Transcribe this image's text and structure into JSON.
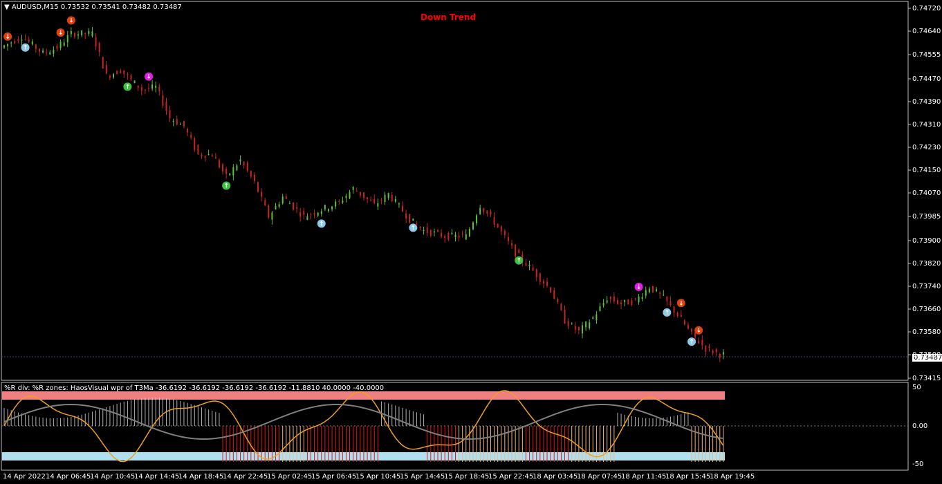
{
  "symbol": {
    "triangle_icon": "down-triangle-icon",
    "text": "AUDUSD,M15  0.73532 0.73541 0.73482 0.73487"
  },
  "trend_label": "Down Trend",
  "indicator_text": "%R div: %R zones: HaosVisual wpr of T3Ma -36.6192 -36.6192 -36.6192 -36.6192 -11.8810 40.0000 -40.0000",
  "current_price": "0.73487",
  "price_axis": [
    "0.74720",
    "0.74640",
    "0.74555",
    "0.74470",
    "0.74390",
    "0.74310",
    "0.74230",
    "0.74150",
    "0.74070",
    "0.73985",
    "0.73900",
    "0.73820",
    "0.73740",
    "0.73660",
    "0.73580",
    "0.73500",
    "0.73415"
  ],
  "indicator_axis": [
    "50",
    "0.00",
    "-50"
  ],
  "time_axis": [
    "14 Apr 2022",
    "14 Apr 06:45",
    "14 Apr 10:45",
    "14 Apr 14:45",
    "14 Apr 18:45",
    "14 Apr 22:45",
    "15 Apr 02:45",
    "15 Apr 06:45",
    "15 Apr 10:45",
    "15 Apr 14:45",
    "15 Apr 18:45",
    "15 Apr 22:45",
    "18 Apr 03:45",
    "18 Apr 07:45",
    "18 Apr 11:45",
    "18 Apr 15:45",
    "18 Apr 19:45"
  ],
  "colors": {
    "background": "#000000",
    "bull_candle": "#5fbf3f",
    "bear_candle": "#c8261e",
    "down_trend_text": "#ff0000",
    "upper_zone": "#f08080",
    "lower_zone": "#b0e0f0",
    "hist_red": "#e01818",
    "hist_orange": "#f5b880",
    "wpr_line": "#f0a020",
    "gray_line": "#808080"
  },
  "chart_data": {
    "type": "candlestick",
    "symbol": "AUDUSD",
    "timeframe": "M15",
    "ohlc_last": {
      "open": 0.73532,
      "high": 0.73541,
      "low": 0.73482,
      "close": 0.73487
    },
    "price_range": [
      0.73415,
      0.7472
    ],
    "path_points": [
      [
        0,
        0.7458
      ],
      [
        6,
        0.7462
      ],
      [
        12,
        0.7456
      ],
      [
        16,
        0.7458
      ],
      [
        20,
        0.7463
      ],
      [
        26,
        0.7463
      ],
      [
        30,
        0.7448
      ],
      [
        34,
        0.745
      ],
      [
        40,
        0.7443
      ],
      [
        44,
        0.7444
      ],
      [
        48,
        0.7433
      ],
      [
        52,
        0.743
      ],
      [
        56,
        0.742
      ],
      [
        60,
        0.742
      ],
      [
        64,
        0.7412
      ],
      [
        68,
        0.7418
      ],
      [
        72,
        0.741
      ],
      [
        76,
        0.7398
      ],
      [
        80,
        0.7405
      ],
      [
        86,
        0.7398
      ],
      [
        90,
        0.74
      ],
      [
        96,
        0.7403
      ],
      [
        100,
        0.7408
      ],
      [
        106,
        0.7402
      ],
      [
        110,
        0.7406
      ],
      [
        116,
        0.7397
      ],
      [
        120,
        0.7393
      ],
      [
        126,
        0.7391
      ],
      [
        132,
        0.7391
      ],
      [
        136,
        0.7402
      ],
      [
        140,
        0.7396
      ],
      [
        146,
        0.7385
      ],
      [
        150,
        0.738
      ],
      [
        156,
        0.7372
      ],
      [
        160,
        0.7361
      ],
      [
        164,
        0.7357
      ],
      [
        168,
        0.7362
      ],
      [
        172,
        0.7369
      ],
      [
        176,
        0.7367
      ],
      [
        180,
        0.7368
      ],
      [
        184,
        0.7373
      ],
      [
        188,
        0.7369
      ],
      [
        192,
        0.7363
      ],
      [
        196,
        0.7356
      ],
      [
        200,
        0.7351
      ],
      [
        204,
        0.7349
      ]
    ],
    "signals": [
      {
        "type": "down",
        "color": "#e04010",
        "i": 1
      },
      {
        "type": "down",
        "color": "#e04010",
        "i": 19
      },
      {
        "type": "down",
        "color": "#e04010",
        "i": 23
      },
      {
        "type": "up",
        "color": "#90c8e8",
        "i": 7
      },
      {
        "type": "down",
        "color": "#e020e0",
        "i": 50
      },
      {
        "type": "up",
        "color": "#40c040",
        "i": 42
      },
      {
        "type": "up",
        "color": "#40c040",
        "i": 76
      },
      {
        "type": "up",
        "color": "#90c8e8",
        "i": 109
      },
      {
        "type": "up",
        "color": "#90c8e8",
        "i": 141
      },
      {
        "type": "up",
        "color": "#40c040",
        "i": 177
      },
      {
        "type": "down",
        "color": "#e020e0",
        "i": 218
      },
      {
        "type": "up",
        "color": "#90c8e8",
        "i": 228
      },
      {
        "type": "down",
        "color": "#e04010",
        "i": 232
      },
      {
        "type": "up",
        "color": "#90c8e8",
        "i": 236
      },
      {
        "type": "down",
        "color": "#e04010",
        "i": 238
      }
    ],
    "indicator_levels": [
      50,
      0,
      -50
    ]
  }
}
